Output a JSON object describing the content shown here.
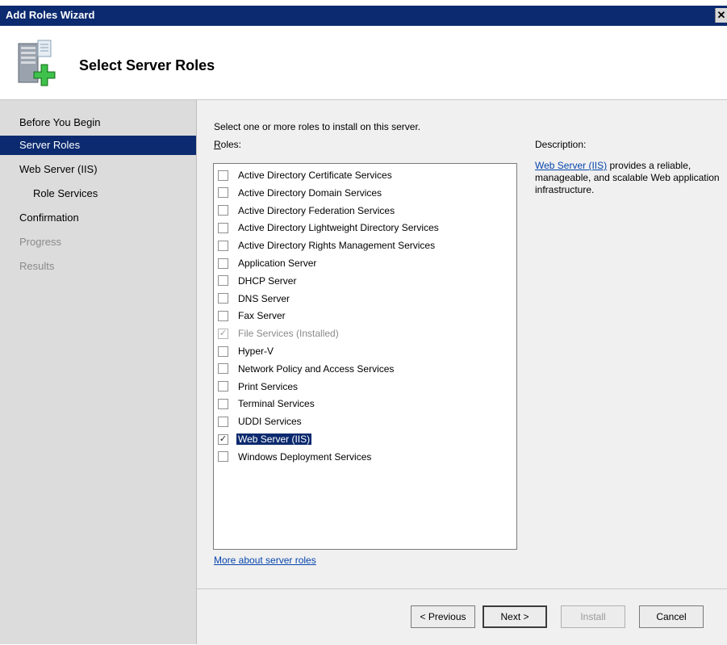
{
  "window": {
    "title": "Add Roles Wizard",
    "close_glyph": "✕"
  },
  "header": {
    "heading": "Select Server Roles",
    "icon": "server-add-icon"
  },
  "sidebar": {
    "items": [
      {
        "label": "Before You Begin",
        "state": "normal"
      },
      {
        "label": "Server Roles",
        "state": "active"
      },
      {
        "label": "Web Server (IIS)",
        "state": "normal"
      },
      {
        "label": "Role Services",
        "state": "sub"
      },
      {
        "label": "Confirmation",
        "state": "normal"
      },
      {
        "label": "Progress",
        "state": "disabled"
      },
      {
        "label": "Results",
        "state": "disabled"
      }
    ]
  },
  "main": {
    "instruction": "Select one or more roles to install on this server.",
    "roles_label_hotkey": "R",
    "roles_label_rest": "oles:",
    "description_label": "Description:",
    "description_link": "Web Server (IIS)",
    "description_text": " provides a reliable, manageable, and scalable Web application infrastructure.",
    "more_link": "More about server roles",
    "roles": [
      {
        "label": "Active Directory Certificate Services",
        "checked": false,
        "disabled": false,
        "selected": false
      },
      {
        "label": "Active Directory Domain Services",
        "checked": false,
        "disabled": false,
        "selected": false
      },
      {
        "label": "Active Directory Federation Services",
        "checked": false,
        "disabled": false,
        "selected": false
      },
      {
        "label": "Active Directory Lightweight Directory Services",
        "checked": false,
        "disabled": false,
        "selected": false
      },
      {
        "label": "Active Directory Rights Management Services",
        "checked": false,
        "disabled": false,
        "selected": false
      },
      {
        "label": "Application Server",
        "checked": false,
        "disabled": false,
        "selected": false
      },
      {
        "label": "DHCP Server",
        "checked": false,
        "disabled": false,
        "selected": false
      },
      {
        "label": "DNS Server",
        "checked": false,
        "disabled": false,
        "selected": false
      },
      {
        "label": "Fax Server",
        "checked": false,
        "disabled": false,
        "selected": false
      },
      {
        "label": "File Services  (Installed)",
        "checked": true,
        "disabled": true,
        "selected": false
      },
      {
        "label": "Hyper-V",
        "checked": false,
        "disabled": false,
        "selected": false
      },
      {
        "label": "Network Policy and Access Services",
        "checked": false,
        "disabled": false,
        "selected": false
      },
      {
        "label": "Print Services",
        "checked": false,
        "disabled": false,
        "selected": false
      },
      {
        "label": "Terminal Services",
        "checked": false,
        "disabled": false,
        "selected": false
      },
      {
        "label": "UDDI Services",
        "checked": false,
        "disabled": false,
        "selected": false
      },
      {
        "label": "Web Server (IIS)",
        "checked": true,
        "disabled": false,
        "selected": true
      },
      {
        "label": "Windows Deployment Services",
        "checked": false,
        "disabled": false,
        "selected": false
      }
    ]
  },
  "footer": {
    "previous_label": "< Previous",
    "next_label": "Next >",
    "install_label": "Install",
    "cancel_label": "Cancel"
  },
  "colors": {
    "titlebar": "#0b2a6f",
    "selection": "#0b2a6f",
    "link": "#0645ad",
    "sidebar": "#dcdcdc",
    "content": "#f0f0f0"
  }
}
